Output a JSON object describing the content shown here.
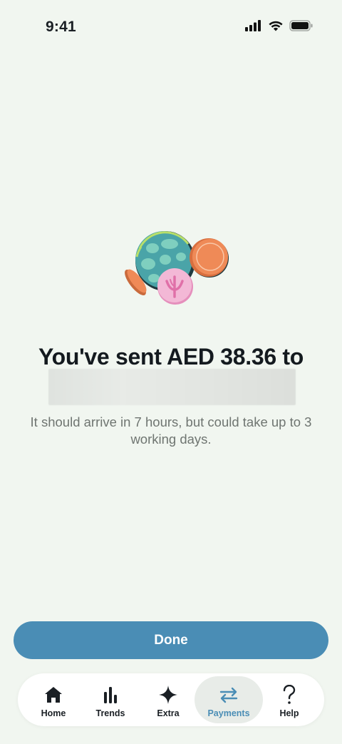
{
  "status_bar": {
    "time": "9:41",
    "icons": [
      "cellular-signal-icon",
      "wifi-icon",
      "battery-icon"
    ]
  },
  "illustration": {
    "name": "coins-illustration",
    "colors": {
      "globe_teal": "#4aa4a8",
      "globe_patch": "#7fcfbf",
      "globe_rim": "#b8df6a",
      "coin_orange": "#ef8a57",
      "coin_pink": "#f3b8d6",
      "shadow_dark": "#1f3a3f"
    }
  },
  "confirmation": {
    "headline": "You've sent AED 38.36 to",
    "subtitle": "It should arrive in 7 hours, but could take up to 3 working days."
  },
  "actions": {
    "done_label": "Done"
  },
  "tab_bar": {
    "active": "Payments",
    "items": [
      {
        "label": "Home",
        "icon": "home-icon"
      },
      {
        "label": "Trends",
        "icon": "bar-chart-icon"
      },
      {
        "label": "Extra",
        "icon": "sparkle-icon"
      },
      {
        "label": "Payments",
        "icon": "transfer-arrows-icon"
      },
      {
        "label": "Help",
        "icon": "question-mark-icon"
      }
    ]
  },
  "colors": {
    "background": "#f1f6f0",
    "accent": "#4a8db5",
    "text_primary": "#141a1f",
    "text_secondary": "#6f7571",
    "tab_active_bg": "#e8ece8"
  }
}
